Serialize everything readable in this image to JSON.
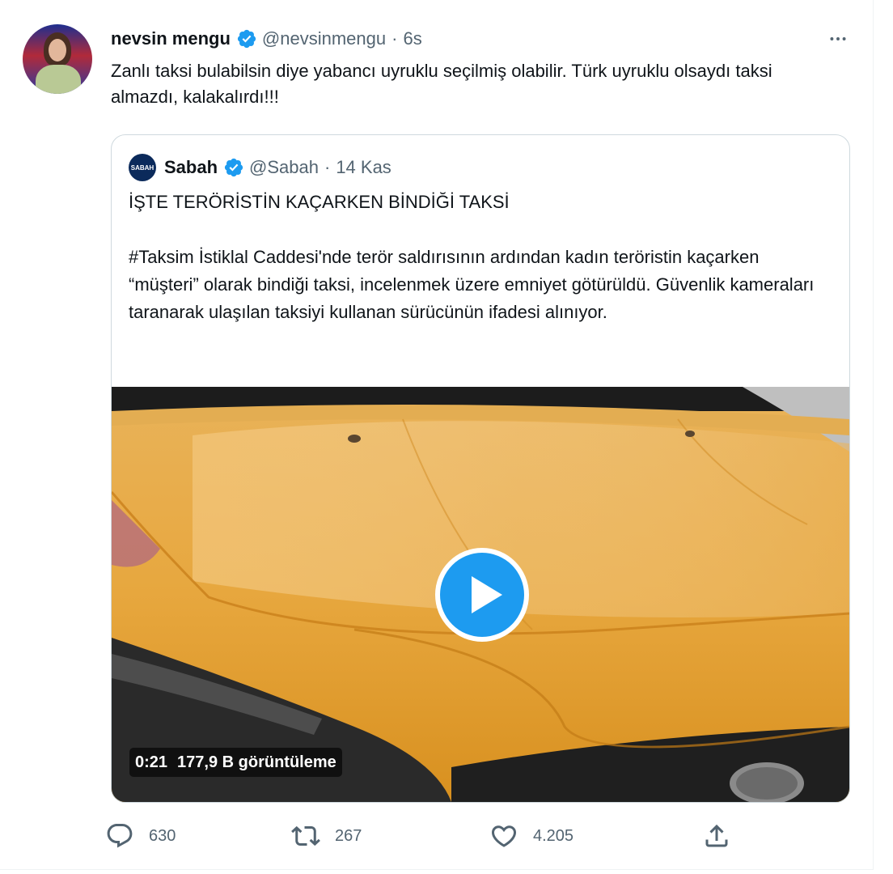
{
  "tweet": {
    "author_name": "nevsin mengu",
    "author_handle": "@nevsinmengu",
    "separator": "·",
    "time": "6s",
    "more_label": "···",
    "text": "Zanlı taksi bulabilsin diye yabancı uyruklu seçilmiş olabilir. Türk uyruklu olsaydı taksi almazdı, kalakalırdı!!!"
  },
  "quote": {
    "logo_text": "SABAH",
    "author_name": "Sabah",
    "author_handle": "@Sabah",
    "separator": "·",
    "time": "14 Kas",
    "headline": "İŞTE TERÖRİSTİN KAÇARKEN BİNDİĞİ TAKSİ",
    "body": "#Taksim İstiklal Caddesi'nde terör saldırısının ardından kadın teröristin kaçarken “müşteri” olarak bindiği taksi, incelenmek üzere emniyet götürüldü. Güvenlik kameraları taranarak ulaşılan taksiyi kullanan sürücünün ifadesi alınıyor.",
    "video": {
      "duration": "0:21",
      "views": "177,9 B görüntüleme"
    }
  },
  "actions": {
    "replies": "630",
    "retweets": "267",
    "likes": "4.205"
  },
  "icons": {
    "verified": "verified-badge-icon",
    "more": "more-dots-icon",
    "play": "play-icon",
    "reply": "reply-icon",
    "retweet": "retweet-icon",
    "like": "heart-icon",
    "share": "share-icon"
  },
  "colors": {
    "verified": "#1d9bf0",
    "text_primary": "#0f1419",
    "text_secondary": "#536471",
    "border": "#cfd9de"
  }
}
